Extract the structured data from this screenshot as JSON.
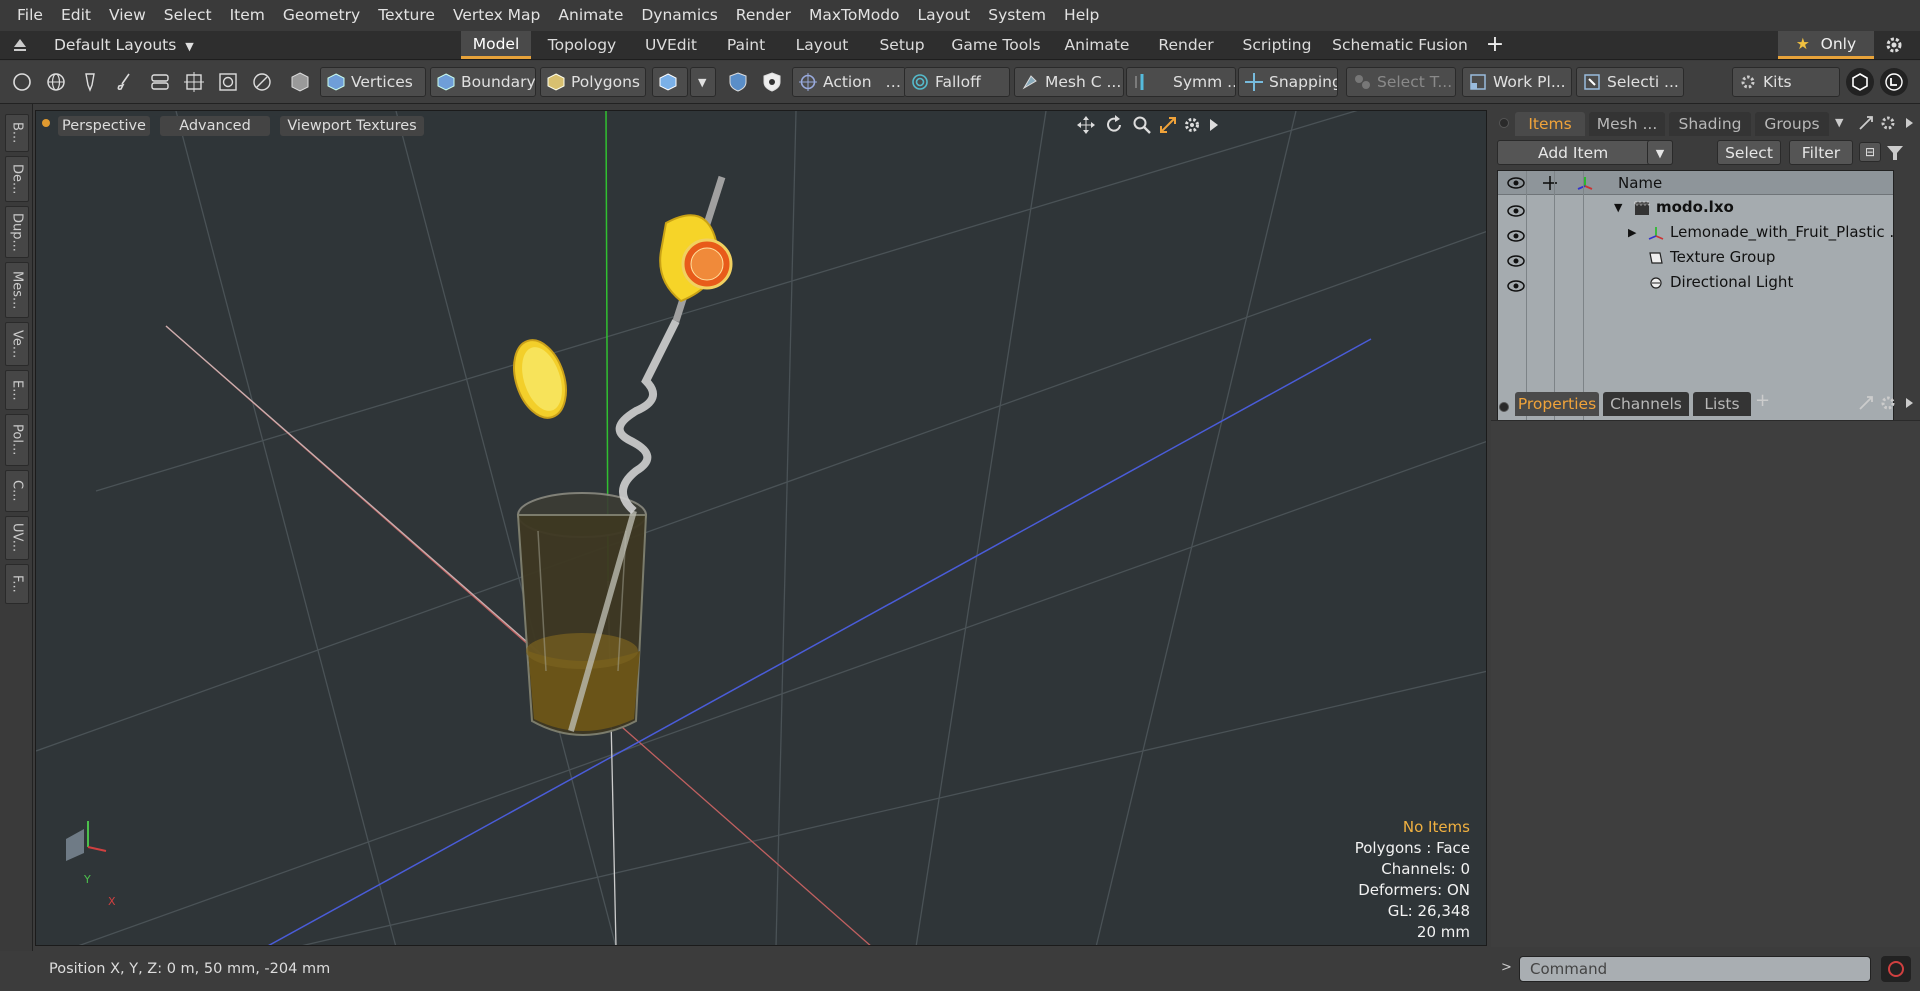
{
  "menu": [
    "File",
    "Edit",
    "View",
    "Select",
    "Item",
    "Geometry",
    "Texture",
    "Vertex Map",
    "Animate",
    "Dynamics",
    "Render",
    "MaxToModo",
    "Layout",
    "System",
    "Help"
  ],
  "layout_selector": "Default Layouts",
  "layout_tabs": [
    {
      "label": "Model",
      "active": true
    },
    {
      "label": "Topology"
    },
    {
      "label": "UVEdit"
    },
    {
      "label": "Paint"
    },
    {
      "label": "Layout"
    },
    {
      "label": "Setup"
    },
    {
      "label": "Game Tools"
    },
    {
      "label": "Animate"
    },
    {
      "label": "Render"
    },
    {
      "label": "Scripting"
    },
    {
      "label": "Schematic Fusion"
    }
  ],
  "only_label": "Only",
  "toolbar": {
    "vertices": "Vertices",
    "boundary": "Boundary",
    "polygons": "Polygons",
    "action": "Action",
    "falloff": "Falloff",
    "meshc": "Mesh C ...",
    "symm": "Symm ...",
    "snapping": "Snapping",
    "selectt": "Select T...",
    "workpl": "Work Pl...",
    "selecti": "Selecti ...",
    "kits": "Kits"
  },
  "left_tabs": [
    "B...",
    "De...",
    "Dup...",
    "Mes...",
    "Ve...",
    "E...",
    "Pol...",
    "C...",
    "UV...",
    "F..."
  ],
  "viewport": {
    "perspective": "Perspective",
    "advanced": "Advanced",
    "textures": "Viewport Textures",
    "info": {
      "no_items": "No Items",
      "polygons": "Polygons : Face",
      "channels": "Channels: 0",
      "deformers": "Deformers: ON",
      "gl": "GL: 26,348",
      "scale": "20 mm"
    },
    "axis_y": "Y",
    "axis_x": "X"
  },
  "status": {
    "position": "Position X, Y, Z:   0 m, 50 mm, -204 mm"
  },
  "items_panel": {
    "tabs": [
      "Items",
      "Mesh ...",
      "Shading",
      "Groups"
    ],
    "add_item": "Add Item",
    "select": "Select",
    "filter": "Filter",
    "name_header": "Name",
    "rows": [
      {
        "label": "modo.lxo"
      },
      {
        "label": "Lemonade_with_Fruit_Plastic ..."
      },
      {
        "label": "Texture Group"
      },
      {
        "label": "Directional Light"
      }
    ]
  },
  "props_panel": {
    "tabs": [
      "Properties",
      "Channels",
      "Lists"
    ]
  },
  "command": {
    "placeholder": "Command"
  },
  "colors": {
    "accent": "#f0a33a",
    "viewport_bg": "#2f3538",
    "x_axis": "#d04040",
    "y_axis": "#30c030",
    "z_axis": "#4a5cd8"
  }
}
